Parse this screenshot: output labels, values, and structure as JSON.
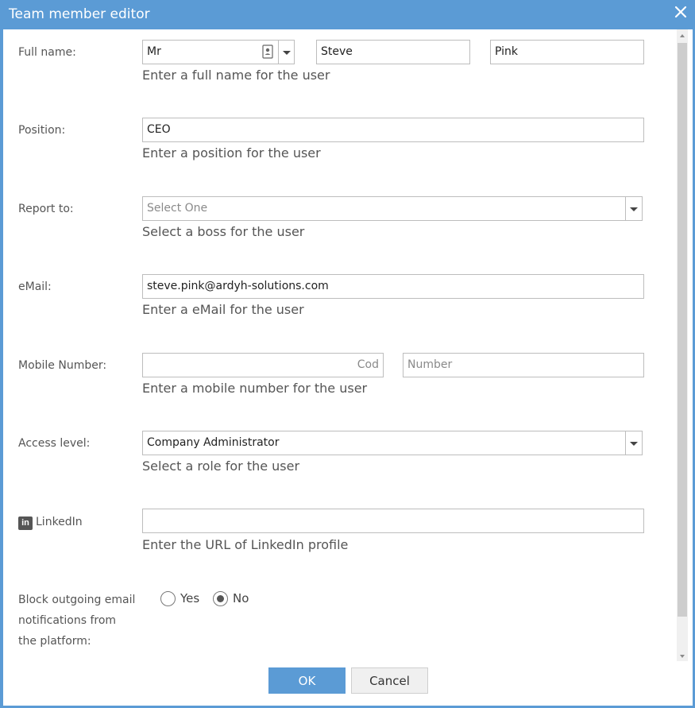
{
  "dialog": {
    "title": "Team member editor"
  },
  "form": {
    "full_name": {
      "label": "Full name:",
      "title_value": "Mr",
      "first_name": "Steve",
      "last_name": "Pink",
      "hint": "Enter a full name for the user"
    },
    "position": {
      "label": "Position:",
      "value": "CEO",
      "hint": "Enter a position for the user"
    },
    "report_to": {
      "label": "Report to:",
      "placeholder": "Select One",
      "hint": "Select a boss for the user"
    },
    "email": {
      "label": "eMail:",
      "value": "steve.pink@ardyh-solutions.com",
      "hint": "Enter a eMail for the user"
    },
    "mobile": {
      "label": "Mobile Number:",
      "code_placeholder": "Cod",
      "number_placeholder": "Number",
      "hint": "Enter a mobile number for the user"
    },
    "access_level": {
      "label": "Access level:",
      "value": "Company Administrator",
      "hint": "Select a role for the user"
    },
    "linkedin": {
      "icon_text": "in",
      "label": "LinkedIn",
      "value": "",
      "hint": "Enter the URL of LinkedIn profile"
    },
    "block_email": {
      "label_line1": "Block outgoing email",
      "label_line2": "notifications from",
      "label_line3": "the platform:",
      "option_yes": "Yes",
      "option_no": "No",
      "selected": "No"
    }
  },
  "buttons": {
    "ok": "OK",
    "cancel": "Cancel"
  },
  "colors": {
    "accent": "#5b9bd5"
  },
  "icons": {
    "close": "close-icon",
    "contact_card": "contact-card-icon",
    "dropdown": "chevron-down-icon",
    "linkedin": "linkedin-icon"
  }
}
